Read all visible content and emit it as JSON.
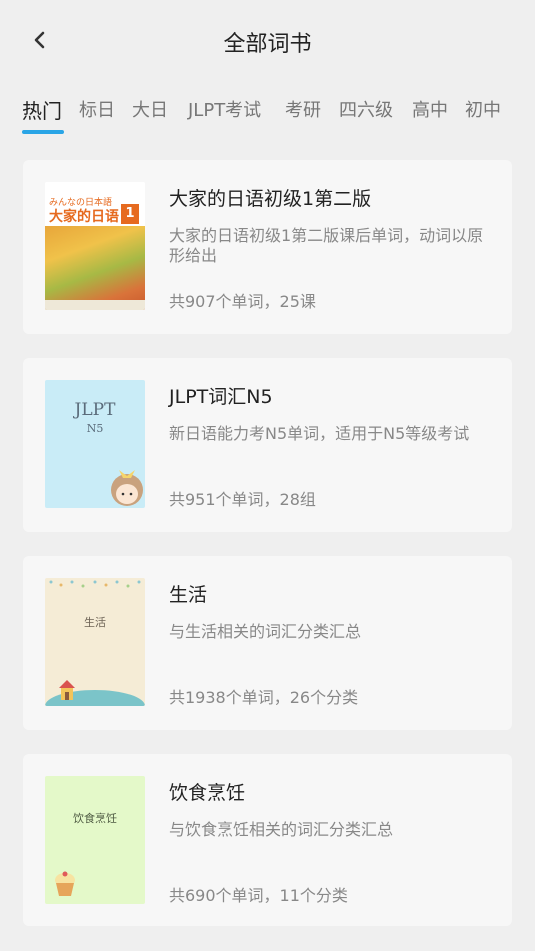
{
  "header": {
    "title": "全部词书"
  },
  "tabs": [
    {
      "label": "热门"
    },
    {
      "label": "标日"
    },
    {
      "label": "大日"
    },
    {
      "label": "JLPT考试"
    },
    {
      "label": "考研"
    },
    {
      "label": "四六级"
    },
    {
      "label": "高中"
    },
    {
      "label": "初中"
    }
  ],
  "books": [
    {
      "title": "大家的日语初级1第二版",
      "description": "大家的日语初级1第二版课后单词，动词以原形给出",
      "meta": "共907个单词，25课",
      "cover": {
        "jp": "みんなの日本語",
        "main": "大家的日语",
        "badge": "1"
      }
    },
    {
      "title": "JLPT词汇N5",
      "description": "新日语能力考N5单词，适用于N5等级考试",
      "meta": "共951个单词，28组",
      "cover": {
        "line1": "JLPT",
        "line2": "N5"
      }
    },
    {
      "title": "生活",
      "description": "与生活相关的词汇分类汇总",
      "meta": "共1938个单词，26个分类",
      "cover": {
        "text": "生活"
      }
    },
    {
      "title": "饮食烹饪",
      "description": "与饮食烹饪相关的词汇分类汇总",
      "meta": "共690个单词，11个分类",
      "cover": {
        "text": "饮食烹饪"
      }
    }
  ],
  "colors": {
    "accent": "#2aa5e6",
    "background": "#efefef",
    "card": "#f7f7f7"
  },
  "icons": {
    "back": "chevron-left-icon"
  }
}
